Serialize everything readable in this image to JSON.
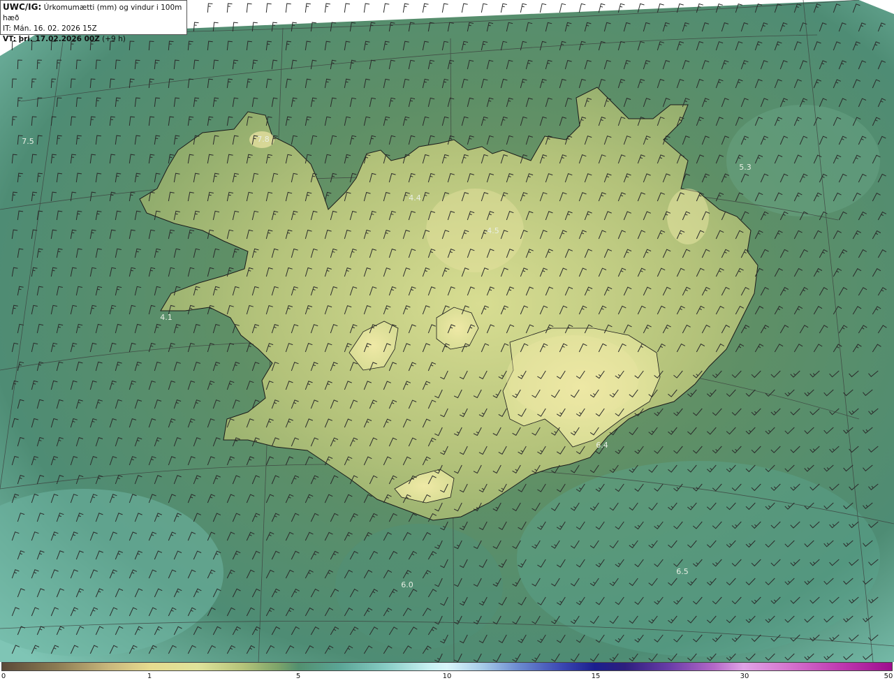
{
  "header": {
    "line1_bold": "UWC/IG:",
    "line1_rest": "Úrkomumætti (mm) og vindur i 100m hæð",
    "line2": "IT: Mán. 16. 02. 2026 15Z",
    "line3_bold": "VT: þri. 17.02.2026 00Z",
    "line3_rest": "(+9 h)"
  },
  "map_labels": [
    "7.5",
    "7.8",
    "4.4",
    "4.5",
    "5.3",
    "4.1",
    "6.4",
    "6.0",
    "6.5"
  ],
  "colorbar_ticks": [
    "0",
    "1",
    "5",
    "10",
    "15",
    "30",
    "50"
  ],
  "colors": {
    "land_light": "#dfe39a",
    "land_mid": "#a9bd76",
    "sea_dark": "#3f7f6a",
    "sea_light": "#7fc5b5",
    "coast": "#1a1a1a",
    "barb": "#2a2a2a"
  }
}
